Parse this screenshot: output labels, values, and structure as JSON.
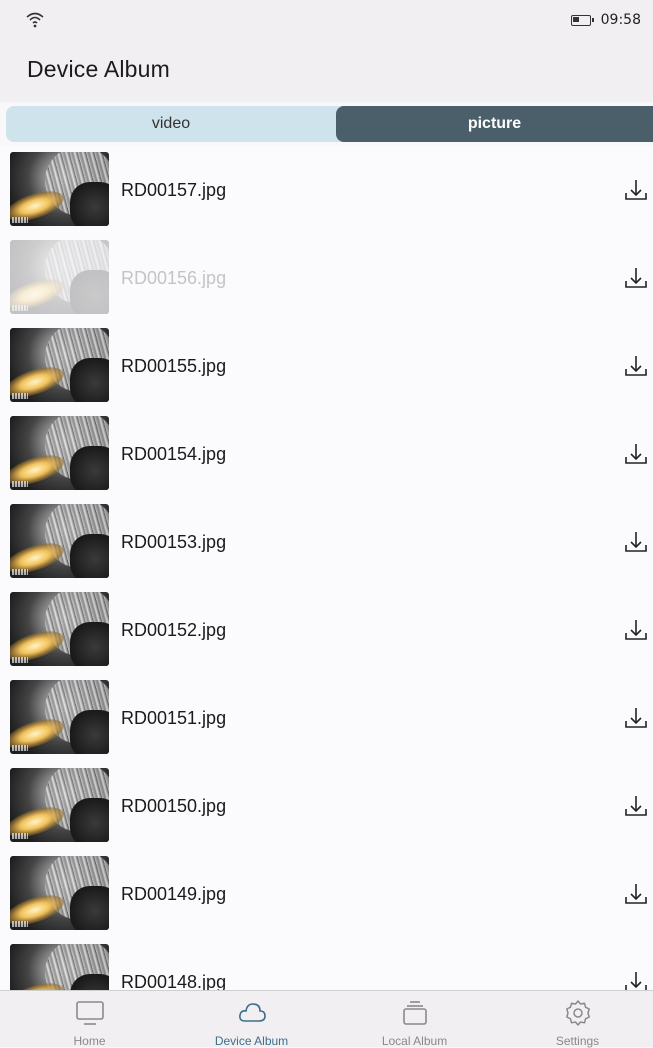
{
  "status": {
    "time": "09:58",
    "wifi_icon": "wifi-icon",
    "battery_icon": "battery-icon"
  },
  "header": {
    "title": "Device Album"
  },
  "tabs": [
    {
      "label": "video",
      "selected": false
    },
    {
      "label": "picture",
      "selected": true
    }
  ],
  "files": [
    {
      "name": "RD00157.jpg",
      "faded": false
    },
    {
      "name": "RD00156.jpg",
      "faded": true
    },
    {
      "name": "RD00155.jpg",
      "faded": false
    },
    {
      "name": "RD00154.jpg",
      "faded": false
    },
    {
      "name": "RD00153.jpg",
      "faded": false
    },
    {
      "name": "RD00152.jpg",
      "faded": false
    },
    {
      "name": "RD00151.jpg",
      "faded": false
    },
    {
      "name": "RD00150.jpg",
      "faded": false
    },
    {
      "name": "RD00149.jpg",
      "faded": false
    },
    {
      "name": "RD00148.jpg",
      "faded": false
    }
  ],
  "nav": [
    {
      "label": "Home",
      "icon": "monitor-icon",
      "active": false
    },
    {
      "label": "Device Album",
      "icon": "cloud-icon",
      "active": true
    },
    {
      "label": "Local Album",
      "icon": "stack-icon",
      "active": false
    },
    {
      "label": "Settings",
      "icon": "gear-icon",
      "active": false
    }
  ],
  "colors": {
    "accent": "#3e6f8a",
    "tab_selected": "#4b5f6a",
    "tab_bg": "#cfe3ed"
  }
}
